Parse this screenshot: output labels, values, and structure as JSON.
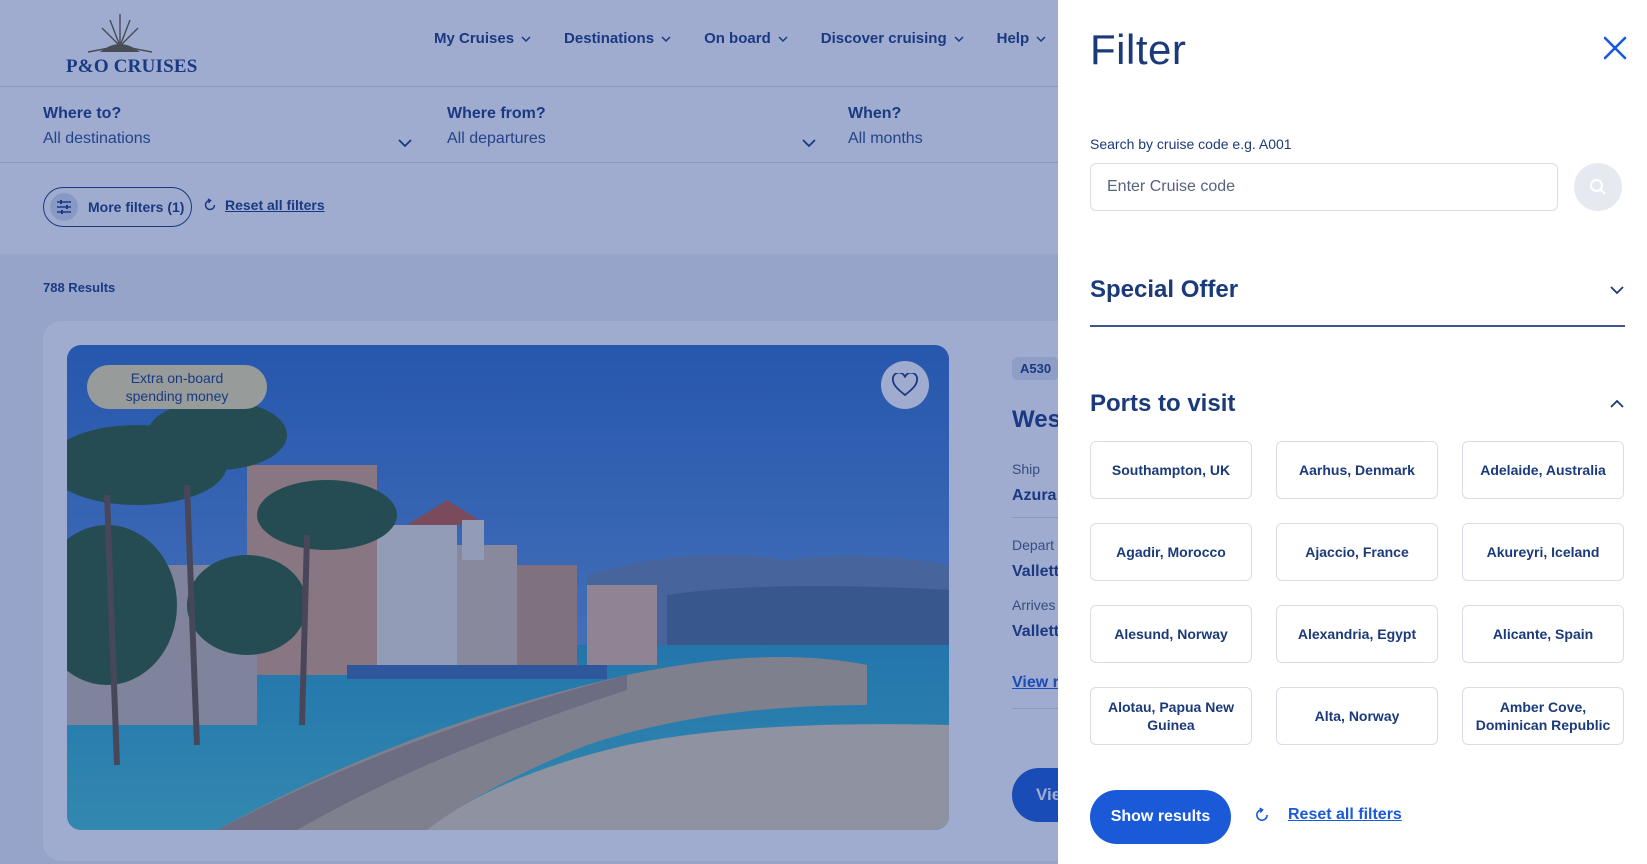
{
  "brand": {
    "name": "P&O CRUISES"
  },
  "nav": {
    "items": [
      {
        "label": "My Cruises"
      },
      {
        "label": "Destinations"
      },
      {
        "label": "On board"
      },
      {
        "label": "Discover cruising"
      },
      {
        "label": "Help"
      }
    ]
  },
  "search": {
    "where_to": {
      "label": "Where to?",
      "value": "All destinations"
    },
    "where_from": {
      "label": "Where from?",
      "value": "All departures"
    },
    "when": {
      "label": "When?",
      "value": "All months"
    }
  },
  "filters_bar": {
    "more_filters_label": "More filters (1)",
    "reset_label": "Reset all filters"
  },
  "results": {
    "count_label": "788 Results",
    "card": {
      "offer_badge": "Extra on-board spending money",
      "code": "A530",
      "title_visible": "Wes",
      "ship_label": "Ship",
      "ship_value": "Azura",
      "departs_label": "Depart",
      "departs_value": "Vallett",
      "arrives_label": "Arrives",
      "arrives_value": "Vallett",
      "link_label": "View r",
      "button_label": "Vie"
    }
  },
  "drawer": {
    "title": "Filter",
    "code_search": {
      "label": "Search by cruise code e.g. A001",
      "placeholder": "Enter Cruise code"
    },
    "sections": {
      "special_offer": "Special Offer",
      "ports": "Ports to visit"
    },
    "ports": [
      "Southampton, UK",
      "Aarhus, Denmark",
      "Adelaide, Australia",
      "Agadir, Morocco",
      "Ajaccio, France",
      "Akureyri, Iceland",
      "Alesund, Norway",
      "Alexandria, Egypt",
      "Alicante, Spain",
      "Alotau, Papua New Guinea",
      "Alta, Norway",
      "Amber Cove, Dominican Republic"
    ],
    "show_results_label": "Show results",
    "reset_label": "Reset all filters"
  },
  "colors": {
    "navy": "#1b3a7a",
    "accent_blue": "#1a5ad8",
    "overlay": "#1b3a8c",
    "offer_badge": "#f2e3a6"
  },
  "icons": {
    "close": "close-icon",
    "search": "search-icon",
    "chevron": "chevron-down-icon",
    "reset": "refresh-icon",
    "heart": "heart-icon",
    "filters": "sliders-icon"
  }
}
